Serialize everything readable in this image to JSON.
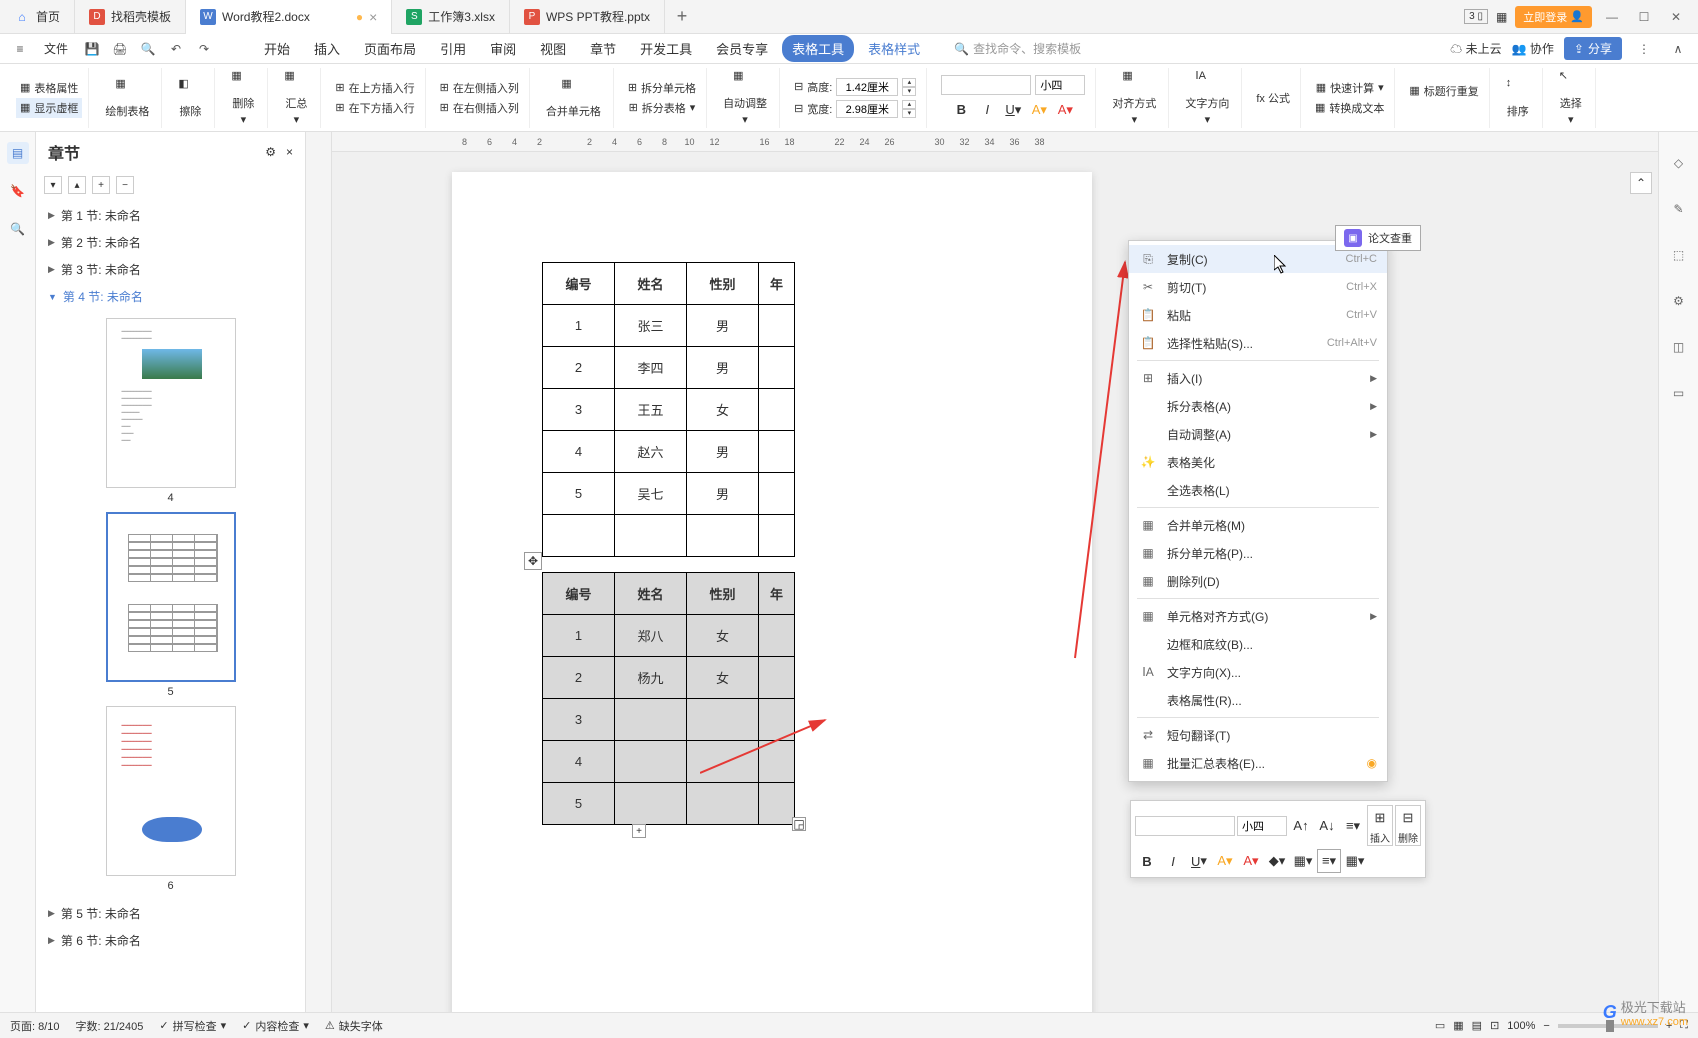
{
  "tabs": {
    "home": "首页",
    "t1": "找稻壳模板",
    "t2": "Word教程2.docx",
    "t3": "工作簿3.xlsx",
    "t4": "WPS PPT教程.pptx"
  },
  "topright": {
    "login": "立即登录"
  },
  "menu": {
    "file": "文件",
    "tabs": [
      "开始",
      "插入",
      "页面布局",
      "引用",
      "审阅",
      "视图",
      "章节",
      "开发工具",
      "会员专享"
    ],
    "tool": "表格工具",
    "style": "表格样式",
    "search_placeholder": "查找命令、搜索模板",
    "cloud": "未上云",
    "collab": "协作",
    "share": "分享"
  },
  "ribbon": {
    "table_props": "表格属性",
    "show_border": "显示虚框",
    "draw_table": "绘制表格",
    "eraser": "擦除",
    "delete": "删除",
    "summary": "汇总",
    "ins_above": "在上方插入行",
    "ins_below": "在下方插入行",
    "ins_left": "在左侧插入列",
    "ins_right": "在右侧插入列",
    "merge": "合并单元格",
    "split_cell": "拆分单元格",
    "split_table": "拆分表格",
    "auto_adjust": "自动调整",
    "height_label": "高度:",
    "width_label": "宽度:",
    "height_val": "1.42厘米",
    "width_val": "2.98厘米",
    "font_size": "小四",
    "align": "对齐方式",
    "text_dir": "文字方向",
    "formula": "fx 公式",
    "quick_calc": "快速计算",
    "title_repeat": "标题行重复",
    "to_text": "转换成文本",
    "sort": "排序",
    "select": "选择"
  },
  "nav": {
    "title": "章节",
    "items": [
      "第 1 节: 未命名",
      "第 2 节: 未命名",
      "第 3 节: 未命名",
      "第 4 节: 未命名",
      "第 5 节: 未命名",
      "第 6 节: 未命名"
    ],
    "thumb_labels": [
      "4",
      "5",
      "6"
    ]
  },
  "hruler": [
    "8",
    "6",
    "4",
    "2",
    "",
    "2",
    "4",
    "6",
    "8",
    "10",
    "12",
    "",
    "16",
    "18",
    "",
    "22",
    "24",
    "26",
    "",
    "30",
    "32",
    "34",
    "36",
    "38"
  ],
  "table1": {
    "headers": [
      "编号",
      "姓名",
      "性别",
      "年"
    ],
    "rows": [
      [
        "1",
        "张三",
        "男",
        ""
      ],
      [
        "2",
        "李四",
        "男",
        ""
      ],
      [
        "3",
        "王五",
        "女",
        ""
      ],
      [
        "4",
        "赵六",
        "男",
        ""
      ],
      [
        "5",
        "吴七",
        "男",
        ""
      ],
      [
        "",
        "",
        "",
        ""
      ]
    ]
  },
  "table2": {
    "headers": [
      "编号",
      "姓名",
      "性别",
      "年"
    ],
    "rows": [
      [
        "1",
        "郑八",
        "女",
        ""
      ],
      [
        "2",
        "杨九",
        "女",
        ""
      ],
      [
        "3",
        "",
        "",
        ""
      ],
      [
        "4",
        "",
        "",
        ""
      ],
      [
        "5",
        "",
        "",
        ""
      ]
    ]
  },
  "ctx": {
    "copy": "复制(C)",
    "copy_sc": "Ctrl+C",
    "cut": "剪切(T)",
    "cut_sc": "Ctrl+X",
    "paste": "粘贴",
    "paste_sc": "Ctrl+V",
    "paste_special": "选择性粘贴(S)...",
    "paste_special_sc": "Ctrl+Alt+V",
    "insert": "插入(I)",
    "split_table": "拆分表格(A)",
    "auto_adjust": "自动调整(A)",
    "beautify": "表格美化",
    "select_all": "全选表格(L)",
    "merge": "合并单元格(M)",
    "split_cell": "拆分单元格(P)...",
    "del_col": "删除列(D)",
    "cell_align": "单元格对齐方式(G)",
    "border_shade": "边框和底纹(B)...",
    "text_dir": "文字方向(X)...",
    "table_props": "表格属性(R)...",
    "translate": "短句翻译(T)",
    "batch": "批量汇总表格(E)..."
  },
  "float": {
    "font": "",
    "size": "小四",
    "insert": "插入",
    "delete": "删除"
  },
  "callout": "论文查重",
  "status": {
    "page": "页面: 8/10",
    "words": "字数: 21/2405",
    "spell": "拼写检查",
    "content": "内容检查",
    "fonts": "缺失字体",
    "zoom": "100%"
  },
  "watermark": {
    "brand": "极光下载站",
    "url": "www.xz7.com"
  }
}
